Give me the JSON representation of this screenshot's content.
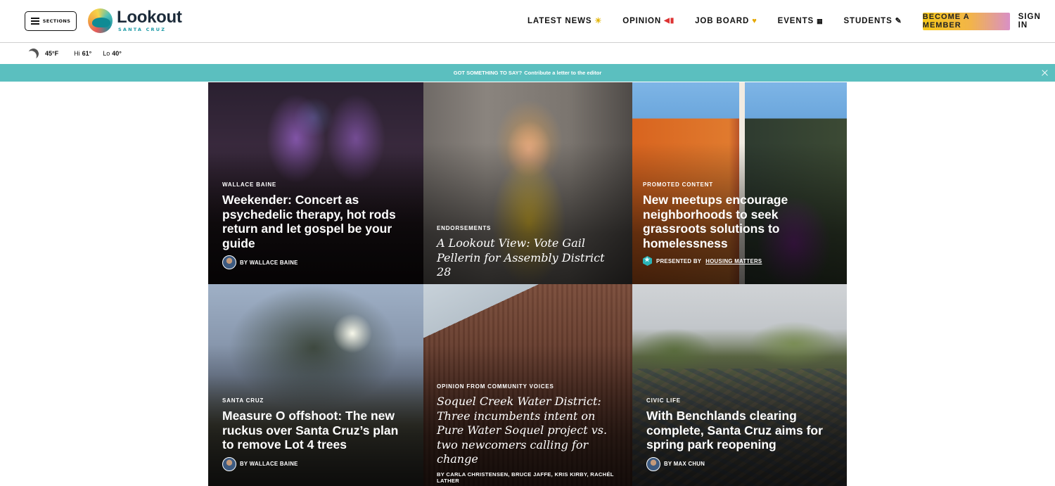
{
  "header": {
    "sections_label": "SECTIONS",
    "logo": {
      "name": "Lookout",
      "sub": "SANTA CRUZ"
    },
    "nav": [
      {
        "label": "LATEST NEWS",
        "icon": "sun-icon",
        "glyph": "☀"
      },
      {
        "label": "OPINION",
        "icon": "megaphone-icon",
        "glyph": "📢"
      },
      {
        "label": "JOB BOARD",
        "icon": "heart-icon",
        "glyph": "♥"
      },
      {
        "label": "EVENTS",
        "icon": "calendar-icon",
        "glyph": "▦"
      },
      {
        "label": "STUDENTS",
        "icon": "pencil-icon",
        "glyph": "✎"
      }
    ],
    "member_label": "BECOME A MEMBER",
    "signin_label": "SIGN IN",
    "search_icon": "search-icon"
  },
  "weather": {
    "icon": "moon-icon",
    "temp": "45°F",
    "hi_label": "Hi",
    "hi": "61°",
    "lo_label": "Lo",
    "lo": "40°"
  },
  "banner": {
    "prefix": "GOT SOMETHING TO SAY?",
    "link": "Contribute a letter to the editor"
  },
  "cards": [
    {
      "kicker": "WALLACE BAINE",
      "headline": "Weekender: Concert as psychedelic therapy, hot rods return and let gospel be your guide",
      "byline": "BY WALLACE BAINE"
    },
    {
      "kicker": "ENDORSEMENTS",
      "headline": "A Lookout View: Vote Gail Pellerin for Assembly District 28"
    },
    {
      "kicker": "PROMOTED CONTENT",
      "headline": "New meetups encourage neighborhoods to seek grassroots solutions to homelessness",
      "presented_label": "PRESENTED BY",
      "sponsor": "HOUSING MATTERS"
    },
    {
      "kicker": "SANTA CRUZ",
      "headline": "Measure O offshoot: The new ruckus over Santa Cruz’s plan to remove Lot 4 trees",
      "byline": "BY WALLACE BAINE"
    },
    {
      "kicker": "OPINION FROM COMMUNITY VOICES",
      "headline": "Soquel Creek Water District: Three incumbents intent on Pure Water Soquel project vs. two newcomers calling for change",
      "byline": "BY CARLA CHRISTENSEN, BRUCE JAFFE, KRIS KIRBY, RACHÉL LATHER"
    },
    {
      "kicker": "CIVIC LIFE",
      "headline": "With Benchlands clearing complete, Santa Cruz aims for spring park reopening",
      "byline": "BY MAX CHUN"
    }
  ],
  "colors": {
    "banner": "#5bbfbf",
    "member_gradient_start": "#f7c919",
    "member_gradient_end": "#d990c6",
    "brand_teal": "#1a9aa6"
  }
}
